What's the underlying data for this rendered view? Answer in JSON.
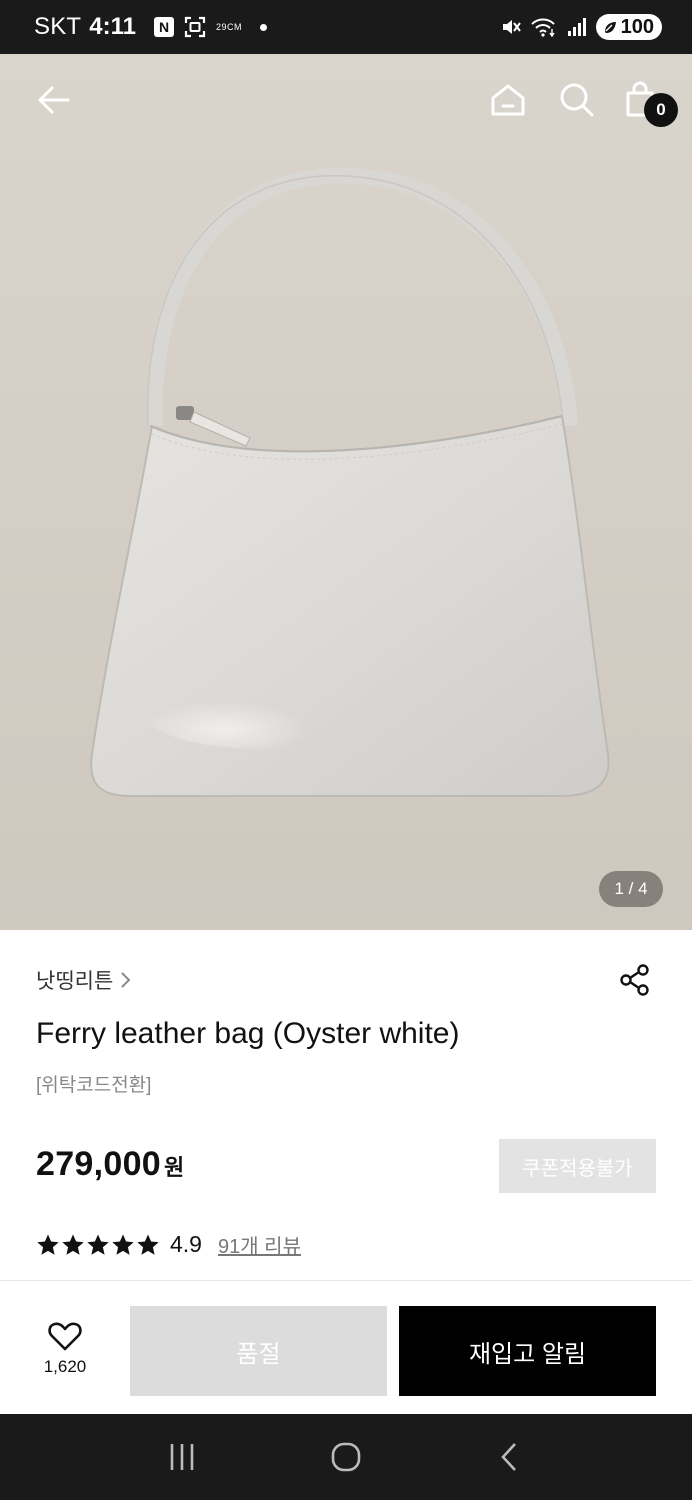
{
  "status_bar": {
    "carrier": "SKT",
    "time": "4:11",
    "notif_badge": "N",
    "tiny_label": "29CM",
    "battery": "100",
    "icons": [
      "n-notification-icon",
      "screen-scan-icon",
      "mute-icon",
      "wifi-icon",
      "signal-icon",
      "battery-icon"
    ]
  },
  "header": {
    "back_icon": "arrow-left-icon",
    "home_icon": "home-icon",
    "search_icon": "search-icon",
    "cart_icon": "shopping-bag-icon",
    "cart_count": "0"
  },
  "gallery": {
    "page_indicator": "1 / 4"
  },
  "product": {
    "brand": "낫띵리튼",
    "brand_chevron": ">",
    "title": "Ferry leather bag (Oyster white)",
    "subtitle": "[위탁코드전환]",
    "price": "279,000",
    "currency": "원",
    "coupon_label": "쿠폰적용불가",
    "rating": "4.9",
    "rating_stars": 5,
    "review_link": "91개 리뷰"
  },
  "actions": {
    "wish_count": "1,620",
    "soldout_label": "품절",
    "restock_label": "재입고 알림"
  },
  "colors": {
    "accent": "#000000",
    "disabled": "#dcdcdc",
    "hero_bg": "#d6d1c9"
  }
}
